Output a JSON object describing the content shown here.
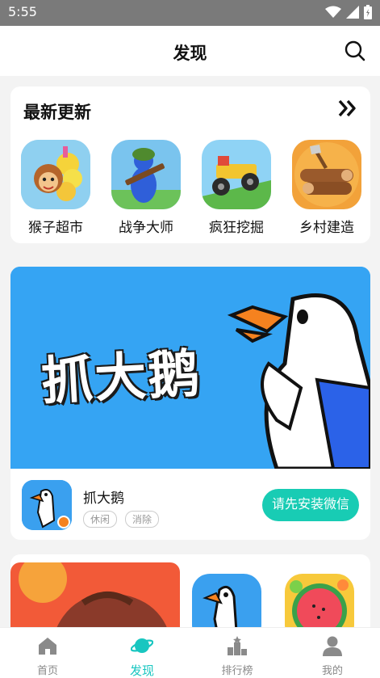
{
  "status": {
    "time": "5:55"
  },
  "header": {
    "title": "发现"
  },
  "latest": {
    "title": "最新更新",
    "apps": [
      {
        "name": "猴子超市"
      },
      {
        "name": "战争大师"
      },
      {
        "name": "疯狂挖掘"
      },
      {
        "name": "乡村建造"
      }
    ]
  },
  "featured": {
    "banner_text": "抓大鹅",
    "name": "抓大鹅",
    "tags": [
      "休闲",
      "消除"
    ],
    "install_label": "请先安装微信"
  },
  "tabs": [
    {
      "label": "首页"
    },
    {
      "label": "发现"
    },
    {
      "label": "排行榜"
    },
    {
      "label": "我的"
    }
  ],
  "colors": {
    "accent": "#18ccb4",
    "active_tab": "#18c6c0",
    "banner_bg": "#35a4f3"
  }
}
